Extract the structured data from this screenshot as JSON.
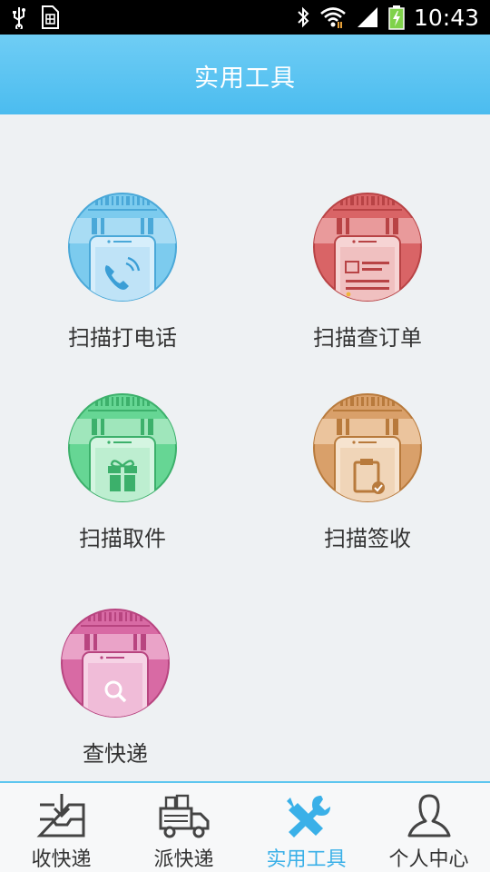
{
  "status_bar": {
    "time": "10:43",
    "icons": [
      "usb-icon",
      "sim-icon",
      "bluetooth-icon",
      "wifi-icon",
      "signal-icon",
      "battery-charging-icon"
    ]
  },
  "header": {
    "title": "实用工具"
  },
  "tools": [
    {
      "label": "扫描打电话",
      "icon": "phone-icon",
      "color": "#6cc2ea"
    },
    {
      "label": "扫描查订单",
      "icon": "order-icon",
      "color": "#d9585a"
    },
    {
      "label": "扫描取件",
      "icon": "gift-icon",
      "color": "#5ed48f"
    },
    {
      "label": "扫描签收",
      "icon": "clipboard-icon",
      "color": "#d89a5e"
    },
    {
      "label": "查快递",
      "icon": "search-icon",
      "color": "#d669a3"
    }
  ],
  "bottom_nav": {
    "items": [
      {
        "label": "收快递",
        "icon": "inbox-icon",
        "active": false
      },
      {
        "label": "派快递",
        "icon": "truck-icon",
        "active": false
      },
      {
        "label": "实用工具",
        "icon": "tools-icon",
        "active": true
      },
      {
        "label": "个人中心",
        "icon": "user-icon",
        "active": false
      }
    ]
  },
  "colors": {
    "header": "#5ac5f2",
    "active_nav": "#3ab0e8"
  }
}
